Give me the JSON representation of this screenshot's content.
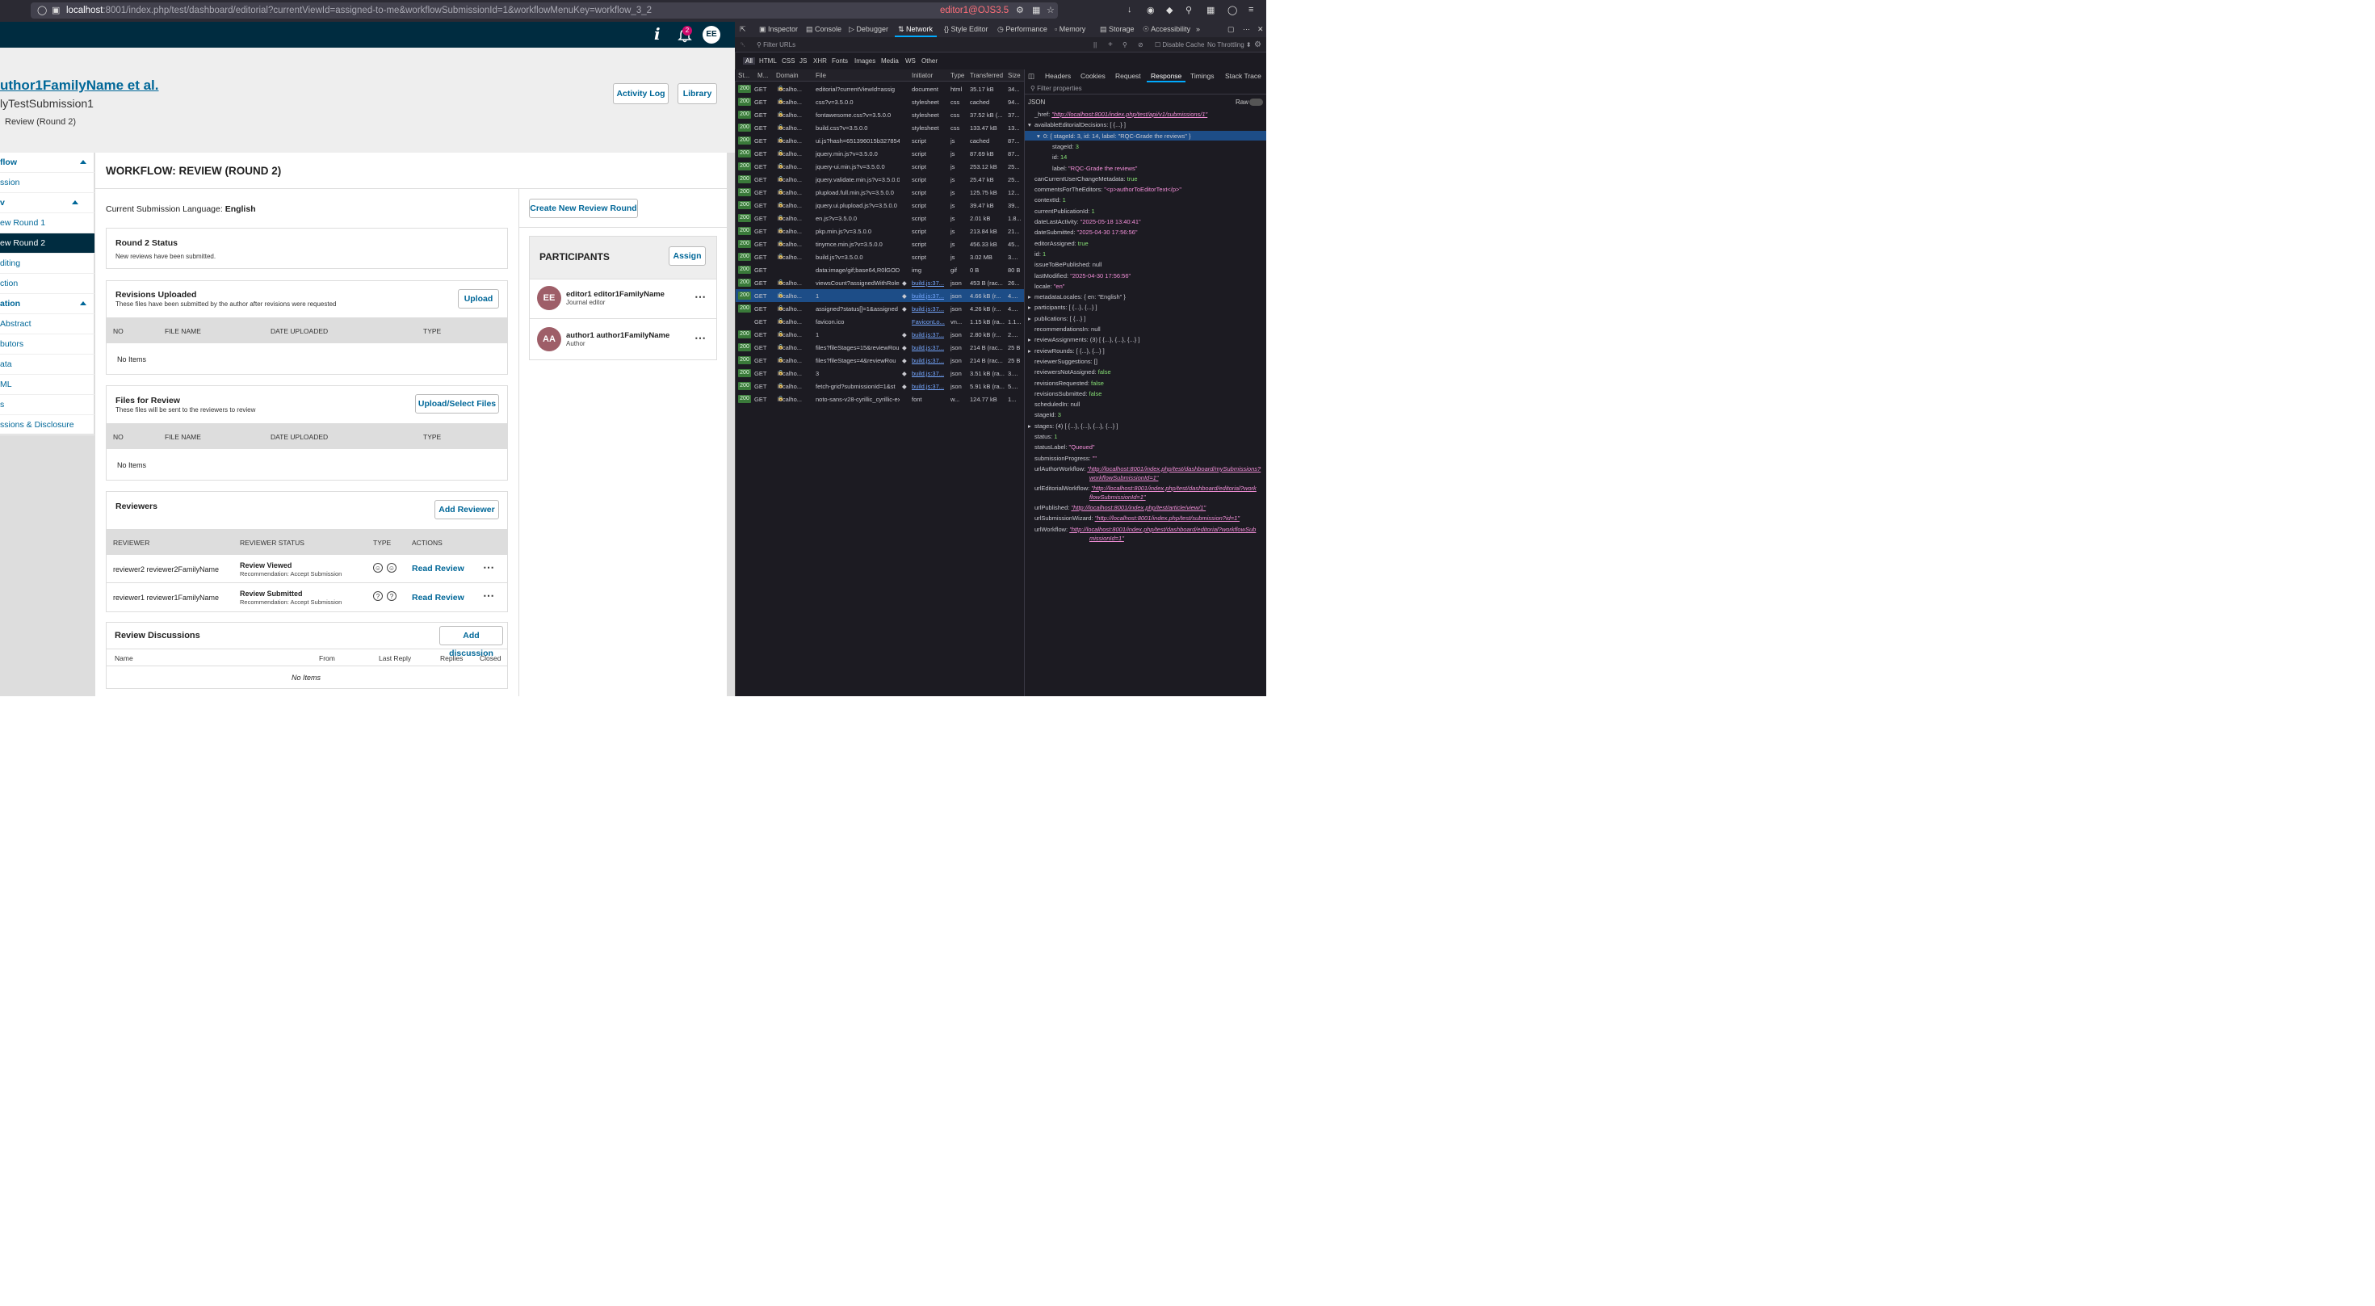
{
  "browser": {
    "url_host": "localhost",
    "url_rest": ":8001/index.php/test/dashboard/editorial?currentViewId=assigned-to-me&workflowSubmissionId=1&workflowMenuKey=workflow_3_2",
    "user_tag": "editor1@OJS3.5"
  },
  "header": {
    "notification_count": "2",
    "avatar_initials": "EE",
    "info_glyph": "i"
  },
  "submission": {
    "authors": "uthor1FamilyName et al.",
    "title": "lyTestSubmission1",
    "stage": "Review (Round 2)",
    "activity_log": "Activity Log",
    "library": "Library"
  },
  "sidebar": {
    "items": [
      {
        "label": "flow",
        "type": "head"
      },
      {
        "label": "ssion",
        "type": "item"
      },
      {
        "label": "v",
        "type": "head"
      },
      {
        "label": "ew Round 1",
        "type": "item"
      },
      {
        "label": "ew Round 2",
        "type": "active"
      },
      {
        "label": "diting",
        "type": "item"
      },
      {
        "label": "ction",
        "type": "item"
      },
      {
        "label": "ation",
        "type": "head"
      },
      {
        "label": " Abstract",
        "type": "item"
      },
      {
        "label": "butors",
        "type": "item"
      },
      {
        "label": "ata",
        "type": "item"
      },
      {
        "label": "ML",
        "type": "item"
      },
      {
        "label": "s",
        "type": "item"
      },
      {
        "label": "ssions & Disclosure",
        "type": "item"
      }
    ]
  },
  "workflow": {
    "title": "WORKFLOW: REVIEW (ROUND 2)",
    "language_label": "Current Submission Language:",
    "language_value": "English",
    "round_status_title": "Round 2 Status",
    "round_status_text": "New reviews have been submitted.",
    "revisions": {
      "title": "Revisions Uploaded",
      "subtitle": "These files have been submitted by the author after revisions were requested",
      "button": "Upload",
      "columns": [
        "NO",
        "FILE NAME",
        "DATE UPLOADED",
        "TYPE"
      ],
      "empty": "No Items"
    },
    "files_review": {
      "title": "Files for Review",
      "subtitle": "These files will be sent to the reviewers to review",
      "button": "Upload/Select Files",
      "columns": [
        "NO",
        "FILE NAME",
        "DATE UPLOADED",
        "TYPE"
      ],
      "empty": "No Items"
    },
    "reviewers": {
      "title": "Reviewers",
      "button": "Add Reviewer",
      "columns": [
        "REVIEWER",
        "REVIEWER STATUS",
        "TYPE",
        "ACTIONS"
      ],
      "rows": [
        {
          "name": "reviewer2 reviewer2FamilyName",
          "status": "Review Viewed",
          "recommendation": "Recommendation: Accept Submission",
          "action": "Read Review",
          "type_icon": "user-circle-icon"
        },
        {
          "name": "reviewer1 reviewer1FamilyName",
          "status": "Review Submitted",
          "recommendation": "Recommendation: Accept Submission",
          "action": "Read Review",
          "type_icon": "question-circle-icon"
        }
      ]
    },
    "discussions": {
      "title": "Review Discussions",
      "button": "Add discussion",
      "columns": [
        "Name",
        "From",
        "Last Reply",
        "Replies",
        "Closed"
      ],
      "empty": "No Items"
    },
    "create_round": "Create New Review Round",
    "participants": {
      "title": "PARTICIPANTS",
      "button": "Assign",
      "people": [
        {
          "initials": "EE",
          "name": "editor1 editor1FamilyName",
          "role": "Journal editor"
        },
        {
          "initials": "AA",
          "name": "author1 author1FamilyName",
          "role": "Author"
        }
      ]
    }
  },
  "devtools": {
    "tabs": [
      "Inspector",
      "Console",
      "Debugger",
      "Network",
      "Style Editor",
      "Performance",
      "Memory",
      "Storage",
      "Accessibility"
    ],
    "selected_tab": "Network",
    "filter_placeholder": "Filter URLs",
    "disable_cache": "Disable Cache",
    "throttling": "No Throttling ⬍",
    "type_filters": [
      "All",
      "HTML",
      "CSS",
      "JS",
      "XHR",
      "Fonts",
      "Images",
      "Media",
      "WS",
      "Other"
    ],
    "columns": [
      "St...",
      "M...",
      "Domain",
      "File",
      "Initiator",
      "Type",
      "Transferred",
      "Size"
    ],
    "requests": [
      {
        "status": "200",
        "method": "GET",
        "domain": "localho...",
        "file": "editorial?currentViewId=assig",
        "initiator": "document",
        "type": "html",
        "transferred": "35.17 kB",
        "size": "34..."
      },
      {
        "status": "200",
        "method": "GET",
        "domain": "localho...",
        "file": "css?v=3.5.0.0",
        "initiator": "stylesheet",
        "type": "css",
        "transferred": "cached",
        "size": "94..."
      },
      {
        "status": "200",
        "method": "GET",
        "domain": "localho...",
        "file": "fontawesome.css?v=3.5.0.0",
        "initiator": "stylesheet",
        "type": "css",
        "transferred": "37.52 kB (...",
        "size": "37..."
      },
      {
        "status": "200",
        "method": "GET",
        "domain": "localho...",
        "file": "build.css?v=3.5.0.0",
        "initiator": "stylesheet",
        "type": "css",
        "transferred": "133.47 kB",
        "size": "13..."
      },
      {
        "status": "200",
        "method": "GET",
        "domain": "localho...",
        "file": "ui.js?hash=651396015b3278543b54",
        "initiator": "script",
        "type": "js",
        "transferred": "cached",
        "size": "87..."
      },
      {
        "status": "200",
        "method": "GET",
        "domain": "localho...",
        "file": "jquery.min.js?v=3.5.0.0",
        "initiator": "script",
        "type": "js",
        "transferred": "87.69 kB",
        "size": "87..."
      },
      {
        "status": "200",
        "method": "GET",
        "domain": "localho...",
        "file": "jquery-ui.min.js?v=3.5.0.0",
        "initiator": "script",
        "type": "js",
        "transferred": "253.12 kB",
        "size": "25..."
      },
      {
        "status": "200",
        "method": "GET",
        "domain": "localho...",
        "file": "jquery.validate.min.js?v=3.5.0.0",
        "initiator": "script",
        "type": "js",
        "transferred": "25.47 kB",
        "size": "25..."
      },
      {
        "status": "200",
        "method": "GET",
        "domain": "localho...",
        "file": "plupload.full.min.js?v=3.5.0.0",
        "initiator": "script",
        "type": "js",
        "transferred": "125.75 kB",
        "size": "12..."
      },
      {
        "status": "200",
        "method": "GET",
        "domain": "localho...",
        "file": "jquery.ui.plupload.js?v=3.5.0.0",
        "initiator": "script",
        "type": "js",
        "transferred": "39.47 kB",
        "size": "39..."
      },
      {
        "status": "200",
        "method": "GET",
        "domain": "localho...",
        "file": "en.js?v=3.5.0.0",
        "initiator": "script",
        "type": "js",
        "transferred": "2.01 kB",
        "size": "1.8..."
      },
      {
        "status": "200",
        "method": "GET",
        "domain": "localho...",
        "file": "pkp.min.js?v=3.5.0.0",
        "initiator": "script",
        "type": "js",
        "transferred": "213.84 kB",
        "size": "21..."
      },
      {
        "status": "200",
        "method": "GET",
        "domain": "localho...",
        "file": "tinymce.min.js?v=3.5.0.0",
        "initiator": "script",
        "type": "js",
        "transferred": "456.33 kB",
        "size": "45..."
      },
      {
        "status": "200",
        "method": "GET",
        "domain": "localho...",
        "file": "build.js?v=3.5.0.0",
        "initiator": "script",
        "type": "js",
        "transferred": "3.02 MB",
        "size": "3...."
      },
      {
        "status": "200",
        "method": "GET",
        "domain": "",
        "file": "data:image/gif;base64,R0lGODlhAC",
        "initiator": "img",
        "type": "gif",
        "transferred": "0 B",
        "size": "80 B"
      },
      {
        "status": "200",
        "method": "GET",
        "domain": "localho...",
        "file": "viewsCount?assignedWithRoles[]=1",
        "initiator": "build.js:37...",
        "type": "json",
        "transferred": "453 B (rac...",
        "size": "26..."
      },
      {
        "status": "200",
        "method": "GET",
        "domain": "localho...",
        "file": "1",
        "initiator": "build.js:37...",
        "type": "json",
        "transferred": "4.66 kB (r...",
        "size": "4....",
        "selected": true
      },
      {
        "status": "200",
        "method": "GET",
        "domain": "localho...",
        "file": "assigned?status[]=1&assigned",
        "initiator": "build.js:37...",
        "type": "json",
        "transferred": "4.26 kB (r...",
        "size": "4...."
      },
      {
        "status": "",
        "method": "GET",
        "domain": "localho...",
        "file": "favicon.ico",
        "initiator": "FaviconLo...",
        "type": "vn...",
        "transferred": "1.15 kB (ra...",
        "size": "1.1..."
      },
      {
        "status": "200",
        "method": "GET",
        "domain": "localho...",
        "file": "1",
        "initiator": "build.js:37...",
        "type": "json",
        "transferred": "2.80 kB (r...",
        "size": "2...."
      },
      {
        "status": "200",
        "method": "GET",
        "domain": "localho...",
        "file": "files?fileStages=15&reviewRou",
        "initiator": "build.js:37...",
        "type": "json",
        "transferred": "214 B (rac...",
        "size": "25 B"
      },
      {
        "status": "200",
        "method": "GET",
        "domain": "localho...",
        "file": "files?fileStages=4&reviewRou",
        "initiator": "build.js:37...",
        "type": "json",
        "transferred": "214 B (rac...",
        "size": "25 B"
      },
      {
        "status": "200",
        "method": "GET",
        "domain": "localho...",
        "file": "3",
        "initiator": "build.js:37...",
        "type": "json",
        "transferred": "3.51 kB (ra...",
        "size": "3...."
      },
      {
        "status": "200",
        "method": "GET",
        "domain": "localho...",
        "file": "fetch-grid?submissionId=1&st",
        "initiator": "build.js:37...",
        "type": "json",
        "transferred": "5.91 kB (ra...",
        "size": "5...."
      },
      {
        "status": "200",
        "method": "GET",
        "domain": "localho...",
        "file": "noto-sans-v28-cyrillic_cyrillic-ext_c",
        "initiator": "font",
        "type": "w...",
        "transferred": "124.77 kB",
        "size": "1..."
      }
    ],
    "response_tabs": [
      "Headers",
      "Cookies",
      "Request",
      "Response",
      "Timings",
      "Stack Trace"
    ],
    "selected_response_tab": "Response",
    "filter_props": "Filter properties",
    "json_label": "JSON",
    "raw_label": "Raw",
    "json_lines": [
      {
        "indent": 0,
        "k": "_href: ",
        "v": "\"http://localhost:8001/index.php/test/api/v1/submissions/1\"",
        "t": "url"
      },
      {
        "indent": 0,
        "k": "availableEditorialDecisions: ",
        "v": "[ {...} ]",
        "t": "plain",
        "tw": "open"
      },
      {
        "indent": 1,
        "k": "0: ",
        "v": "{ stageId: 3, id: 14, label: \"RQC-Grade the reviews\" }",
        "t": "plain",
        "tw": "open",
        "selected": true
      },
      {
        "indent": 2,
        "k": "stageId: ",
        "v": "3",
        "t": "num"
      },
      {
        "indent": 2,
        "k": "id: ",
        "v": "14",
        "t": "num"
      },
      {
        "indent": 2,
        "k": "label: ",
        "v": "\"RQC-Grade the reviews\"",
        "t": "str"
      },
      {
        "indent": 0,
        "k": "canCurrentUserChangeMetadata: ",
        "v": "true",
        "t": "num"
      },
      {
        "indent": 0,
        "k": "commentsForTheEditors: ",
        "v": "\"<p>authorToEditorText</p>\"",
        "t": "str"
      },
      {
        "indent": 0,
        "k": "contextId: ",
        "v": "1",
        "t": "num"
      },
      {
        "indent": 0,
        "k": "currentPublicationId: ",
        "v": "1",
        "t": "num"
      },
      {
        "indent": 0,
        "k": "dateLastActivity: ",
        "v": "\"2025-05-18 13:40:41\"",
        "t": "str"
      },
      {
        "indent": 0,
        "k": "dateSubmitted: ",
        "v": "\"2025-04-30 17:56:56\"",
        "t": "str"
      },
      {
        "indent": 0,
        "k": "editorAssigned: ",
        "v": "true",
        "t": "num"
      },
      {
        "indent": 0,
        "k": "id: ",
        "v": "1",
        "t": "num"
      },
      {
        "indent": 0,
        "k": "issueToBePublished: ",
        "v": "null",
        "t": "null"
      },
      {
        "indent": 0,
        "k": "lastModified: ",
        "v": "\"2025-04-30 17:56:56\"",
        "t": "str"
      },
      {
        "indent": 0,
        "k": "locale: ",
        "v": "\"en\"",
        "t": "str"
      },
      {
        "indent": 0,
        "k": "metadataLocales: ",
        "v": "{ en: \"English\" }",
        "t": "plain",
        "tw": "closed"
      },
      {
        "indent": 0,
        "k": "participants: ",
        "v": "[ {...}, {...} ]",
        "t": "plain",
        "tw": "closed"
      },
      {
        "indent": 0,
        "k": "publications: ",
        "v": "[ {...} ]",
        "t": "plain",
        "tw": "closed"
      },
      {
        "indent": 0,
        "k": "recommendationsIn: ",
        "v": "null",
        "t": "null"
      },
      {
        "indent": 0,
        "k": "reviewAssignments: ",
        "v": "(3) [ {...}, {...}, {...} ]",
        "t": "plain",
        "tw": "closed"
      },
      {
        "indent": 0,
        "k": "reviewRounds: ",
        "v": "[ {...}, {...} ]",
        "t": "plain",
        "tw": "closed"
      },
      {
        "indent": 0,
        "k": "reviewerSuggestions: ",
        "v": "[]",
        "t": "plain"
      },
      {
        "indent": 0,
        "k": "reviewersNotAssigned: ",
        "v": "false",
        "t": "num"
      },
      {
        "indent": 0,
        "k": "revisionsRequested: ",
        "v": "false",
        "t": "num"
      },
      {
        "indent": 0,
        "k": "revisionsSubmitted: ",
        "v": "false",
        "t": "num"
      },
      {
        "indent": 0,
        "k": "scheduledIn: ",
        "v": "null",
        "t": "null"
      },
      {
        "indent": 0,
        "k": "stageId: ",
        "v": "3",
        "t": "num"
      },
      {
        "indent": 0,
        "k": "stages: ",
        "v": "(4) [ {...}, {...}, {...}, {...} ]",
        "t": "plain",
        "tw": "closed"
      },
      {
        "indent": 0,
        "k": "status: ",
        "v": "1",
        "t": "num"
      },
      {
        "indent": 0,
        "k": "statusLabel: ",
        "v": "\"Queued\"",
        "t": "str"
      },
      {
        "indent": 0,
        "k": "submissionProgress: ",
        "v": "\"\"",
        "t": "str"
      },
      {
        "indent": 0,
        "k": "urlAuthorWorkflow: ",
        "v": "\"http://localhost:8001/index.php/test/dashboard/mySubmissions?",
        "v2": "workflowSubmissionId=1\"",
        "t": "url"
      },
      {
        "indent": 0,
        "k": "urlEditorialWorkflow: ",
        "v": "\"http://localhost:8001/index.php/test/dashboard/editorial?work",
        "v2": "flowSubmissionId=1\"",
        "t": "url"
      },
      {
        "indent": 0,
        "k": "urlPublished: ",
        "v": "\"http://localhost:8001/index.php/test/article/view/1\"",
        "t": "url"
      },
      {
        "indent": 0,
        "k": "urlSubmissionWizard: ",
        "v": "\"http://localhost:8001/index.php/test/submission?id=1\"",
        "t": "url"
      },
      {
        "indent": 0,
        "k": "urlWorkflow: ",
        "v": "\"http://localhost:8001/index.php/test/dashboard/editorial?workflowSub",
        "v2": "missionId=1\"",
        "t": "url"
      }
    ]
  }
}
